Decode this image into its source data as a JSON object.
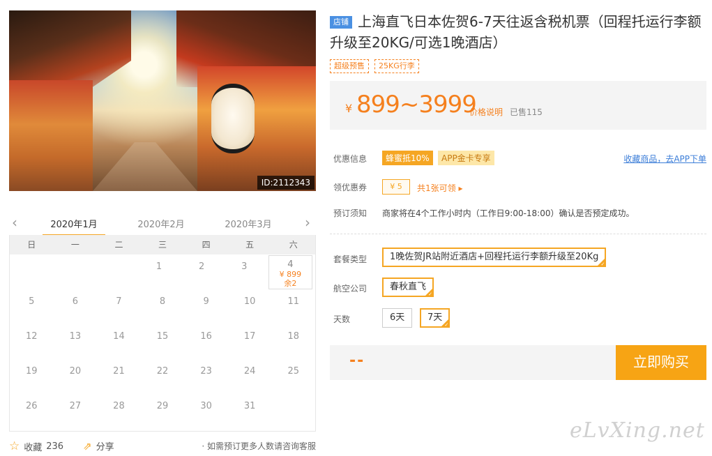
{
  "hero": {
    "image_id": "ID:2112343"
  },
  "calendar": {
    "prev_arrow": "‹",
    "next_arrow": "›",
    "months": [
      "2020年1月",
      "2020年2月",
      "2020年3月"
    ],
    "weekdays": [
      "日",
      "一",
      "二",
      "三",
      "四",
      "五",
      "六"
    ],
    "rows": [
      [
        "",
        "",
        "",
        "1",
        "2",
        "3",
        "4"
      ],
      [
        "5",
        "6",
        "7",
        "8",
        "9",
        "10",
        "11"
      ],
      [
        "12",
        "13",
        "14",
        "15",
        "16",
        "17",
        "18"
      ],
      [
        "19",
        "20",
        "21",
        "22",
        "23",
        "24",
        "25"
      ],
      [
        "26",
        "27",
        "28",
        "29",
        "30",
        "31",
        ""
      ]
    ],
    "selected_price": "¥ 899",
    "selected_remaining": "余2"
  },
  "footer": {
    "favorite_label": "收藏",
    "favorite_count": "236",
    "share_label": "分享",
    "note": "· 如需预订更多人数请咨询客服"
  },
  "product": {
    "shop_badge": "店铺",
    "title": "上海直飞日本佐贺6-7天往返含税机票（回程托运行李额升级至20KG/可选1晚酒店）",
    "tags": [
      "超级预售",
      "25KG行李"
    ],
    "currency": "¥",
    "price_range": "899~3999",
    "price_explain": "价格说明",
    "sold": "已售115"
  },
  "info": {
    "promo_label": "优惠信息",
    "promo1": "蜂蜜抵10%",
    "promo2": "APP金卡专享",
    "fav_link": "收藏商品，去APP下单",
    "coupon_label": "领优惠券",
    "coupon_value": "¥ 5",
    "coupon_link": "共1张可领 ▸",
    "notice_label": "预订须知",
    "notice_text": "商家将在4个工作小时内（工作日9:00-18:00）确认是否预定成功。"
  },
  "options": {
    "package_label": "套餐类型",
    "package_value": "1晚佐贺JR站附近酒店+回程托运行李额升级至20Kg",
    "airline_label": "航空公司",
    "airline_value": "春秋直飞",
    "days_label": "天数",
    "days": [
      "6天",
      "7天"
    ],
    "days_selected": "7天"
  },
  "buy": {
    "total": "--",
    "button": "立即购买"
  },
  "watermark": "eLvXing.net",
  "colors": {
    "accent": "#f5a623",
    "price": "#f5801e",
    "link": "#3b7dd8",
    "shop_badge": "#4a90e2"
  }
}
